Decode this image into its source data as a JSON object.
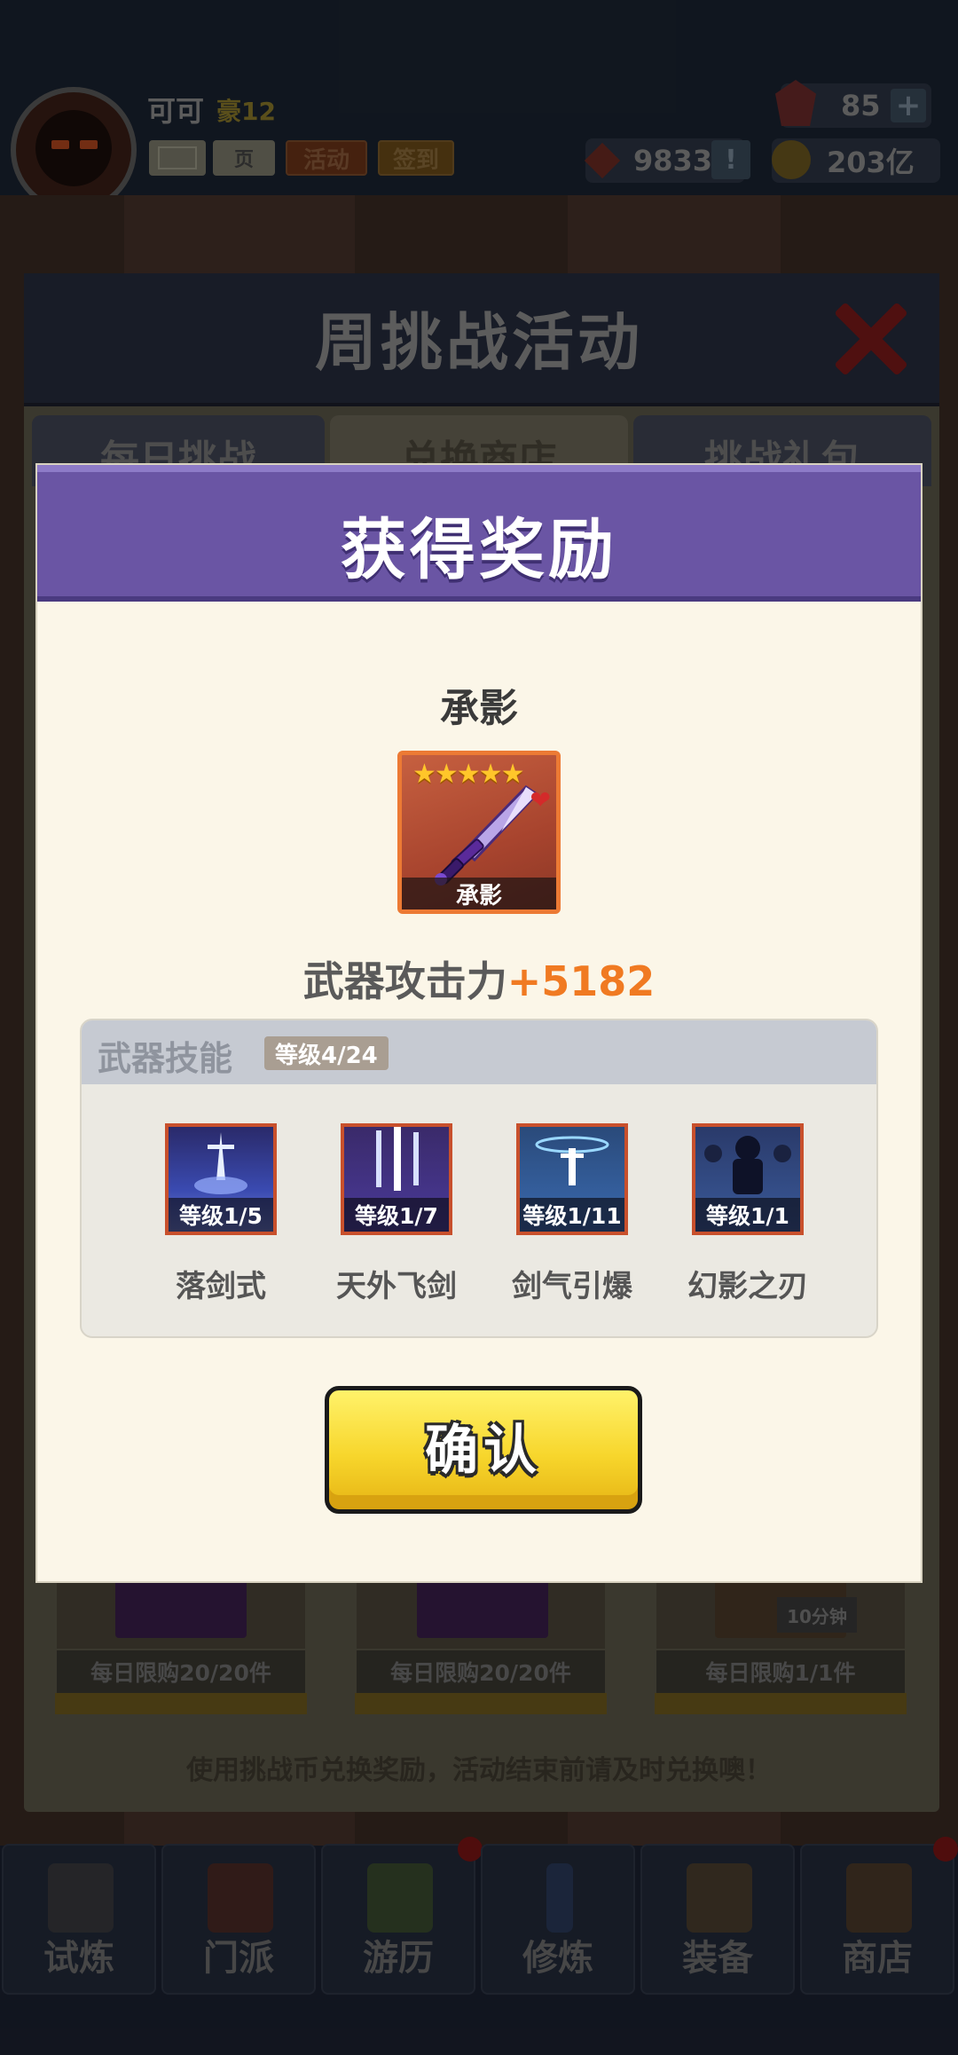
{
  "header": {
    "player_name": "可可",
    "player_level": "豪12",
    "mail_label": "",
    "ext_label": "页",
    "activity_label": "活动",
    "signin_label": "签到",
    "gems": "85",
    "gems_plus": "+",
    "tokens": "9833",
    "tokens_info": "!",
    "coins": "203亿"
  },
  "event_panel": {
    "title": "周挑战活动",
    "tabs": [
      "每日挑战",
      "兑换商店",
      "挑战礼包"
    ],
    "shop_items": [
      {
        "limit": "每日限购20/20件"
      },
      {
        "limit": "每日限购20/20件"
      },
      {
        "limit": "每日限购1/1件",
        "timer": "10分钟"
      }
    ],
    "notice": "使用挑战币兑换奖励，活动结束前请及时兑换噢！"
  },
  "bottom_nav": {
    "items": [
      {
        "label": "试炼",
        "icon": "ninja-icon"
      },
      {
        "label": "门派",
        "icon": "temple-icon"
      },
      {
        "label": "游历",
        "icon": "landscape-icon"
      },
      {
        "label": "修炼",
        "icon": "scroll-icon"
      },
      {
        "label": "装备",
        "icon": "sword-icon"
      },
      {
        "label": "商店",
        "icon": "shop-icon"
      }
    ]
  },
  "reward_modal": {
    "title": "获得奖励",
    "item_name": "承影",
    "item_card_label": "承影",
    "item_stars": "★★★★★",
    "attack_label": "武器攻击力",
    "attack_value": "+5182",
    "skills_title": "武器技能",
    "skills_level": "等级4/24",
    "skills": [
      {
        "name": "落剑式",
        "level": "等级1/5",
        "icon": "falling-sword-icon"
      },
      {
        "name": "天外飞剑",
        "level": "等级1/7",
        "icon": "flying-swords-icon"
      },
      {
        "name": "剑气引爆",
        "level": "等级1/11",
        "icon": "sword-burst-icon"
      },
      {
        "name": "幻影之刃",
        "level": "等级1/1",
        "icon": "phantom-blade-icon"
      }
    ],
    "confirm_label": "确认"
  },
  "colors": {
    "modal_header": "#6a55a4",
    "modal_body": "#fbf6e8",
    "attack_value": "#f07a22",
    "confirm_button": "#f7d62c",
    "item_border": "#ec7a34"
  }
}
